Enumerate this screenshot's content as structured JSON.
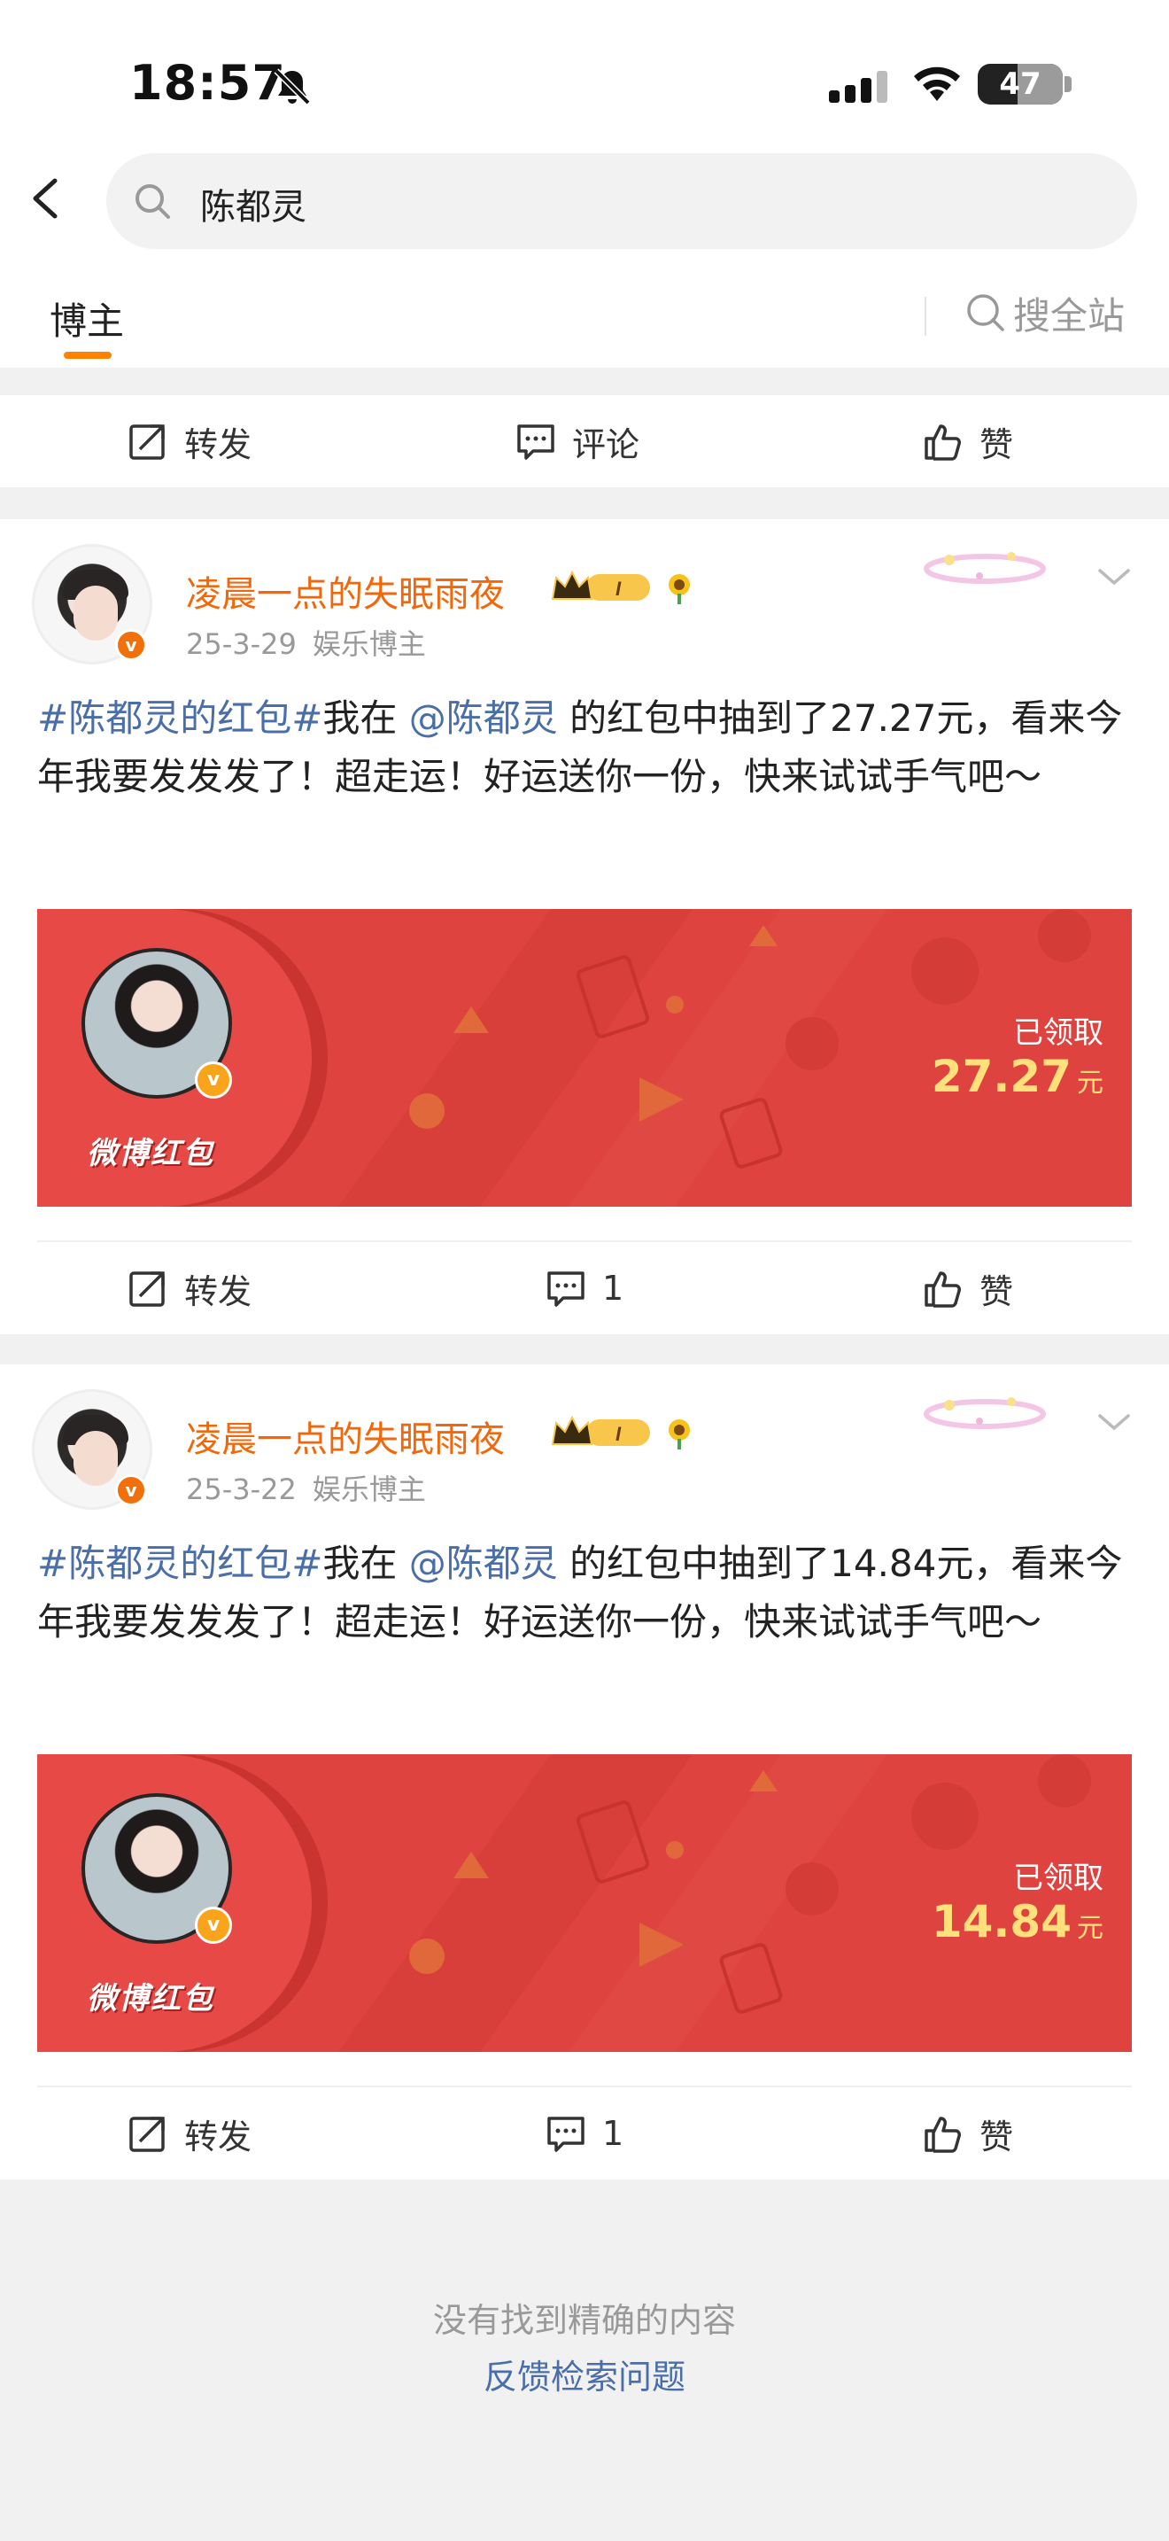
{
  "status_bar": {
    "time": "18:57",
    "battery": "47",
    "battery_level": 0.47
  },
  "search": {
    "query": "陈都灵"
  },
  "tabs": {
    "active": "博主",
    "search_all": "搜全站"
  },
  "top_actions": {
    "repost": "转发",
    "comment": "评论",
    "like": "赞"
  },
  "posts": [
    {
      "username": "凌晨一点的失眠雨夜",
      "date": "25-3-29",
      "category": "娱乐博主",
      "hashtag": "#陈都灵的红包#",
      "text_before_mention": "我在",
      "mention": "@陈都灵",
      "text_after": " 的红包中抽到了27.27元，看来今年我要发发发了！超走运！好运送你一份，快来试试手气吧～",
      "packet": {
        "brand": "微博红包",
        "status": "已领取",
        "amount": "27.27",
        "unit": "元"
      },
      "actions": {
        "repost": "转发",
        "comment": "1",
        "like": "赞"
      }
    },
    {
      "username": "凌晨一点的失眠雨夜",
      "date": "25-3-22",
      "category": "娱乐博主",
      "hashtag": "#陈都灵的红包#",
      "text_before_mention": "我在",
      "mention": "@陈都灵",
      "text_after": " 的红包中抽到了14.84元，看来今年我要发发发了！超走运！好运送你一份，快来试试手气吧～",
      "packet": {
        "brand": "微博红包",
        "status": "已领取",
        "amount": "14.84",
        "unit": "元"
      },
      "actions": {
        "repost": "转发",
        "comment": "1",
        "like": "赞"
      }
    }
  ],
  "footer": {
    "message": "没有找到精确的内容",
    "link": "反馈检索问题"
  },
  "colors": {
    "accent": "#ff8200",
    "username": "#f2670a",
    "link": "#4a6ea8",
    "packet_red": "#df433f",
    "packet_amount": "#ffe07a"
  }
}
